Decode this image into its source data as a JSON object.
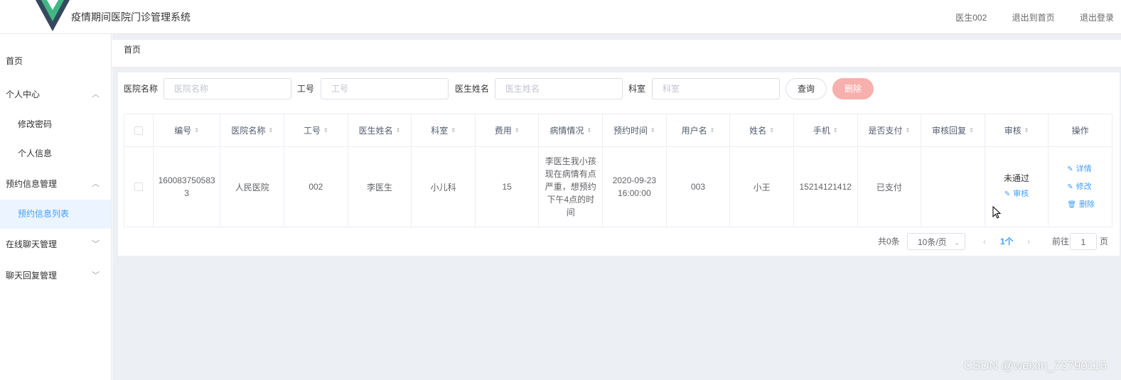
{
  "header": {
    "title": "疫情期间医院门诊管理系统",
    "user": "医生002",
    "back_home": "退出到首页",
    "logout": "退出登录"
  },
  "sidebar": {
    "items": [
      {
        "label": "首页"
      },
      {
        "label": "个人中心",
        "arrow": "︿"
      },
      {
        "label": "修改密码"
      },
      {
        "label": "个人信息"
      },
      {
        "label": "预约信息管理",
        "arrow": "︿"
      },
      {
        "label": "预约信息列表"
      },
      {
        "label": "在线聊天管理",
        "arrow": "﹀"
      },
      {
        "label": "聊天回复管理",
        "arrow": "﹀"
      }
    ]
  },
  "breadcrumb": "首页",
  "search": {
    "hospital_label": "医院名称",
    "hospital_placeholder": "医院名称",
    "jobno_label": "工号",
    "jobno_placeholder": "工号",
    "doctor_label": "医生姓名",
    "doctor_placeholder": "医生姓名",
    "dept_label": "科室",
    "dept_placeholder": "科室",
    "query_button": "查询",
    "delete_button": "删除"
  },
  "table": {
    "headers": [
      "编号",
      "医院名称",
      "工号",
      "医生姓名",
      "科室",
      "费用",
      "病情情况",
      "预约时间",
      "用户名",
      "姓名",
      "手机",
      "是否支付",
      "审核回复",
      "审核",
      "操作"
    ],
    "rows": [
      {
        "id": "1600837505833",
        "hospital": "人民医院",
        "job_no": "002",
        "doctor": "李医生",
        "dept": "小儿科",
        "fee": "15",
        "condition": "李医生我小孩现在病情有点严重，想预约下午4点的时间",
        "time": "2020-09-23 16:00:00",
        "username": "003",
        "name": "小王",
        "phone": "15214121412",
        "paid": "已支付",
        "reply": "",
        "review_status": "未通过",
        "review_action": "审核",
        "op_detail": "详情",
        "op_edit": "修改",
        "op_delete": "删除"
      }
    ]
  },
  "pager": {
    "total": "共0条",
    "page_size": "10条/页",
    "prev": "‹",
    "current": "1个",
    "next": "›",
    "goto_label": "前往",
    "goto_value": "1",
    "page_unit": "页"
  },
  "watermark": "CSDN @weixin_72790115",
  "colors": {
    "primary": "#409eff",
    "delete": "#f7b0ad",
    "logo_green": "#41b883",
    "logo_dark": "#35495e"
  }
}
